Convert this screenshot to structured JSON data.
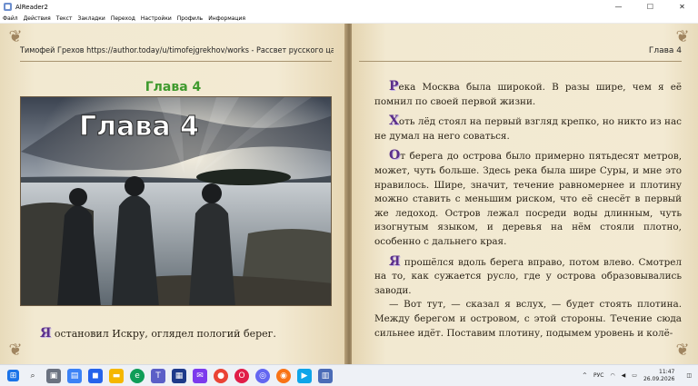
{
  "window": {
    "title": "AlReader2",
    "minimize_glyph": "—",
    "maximize_glyph": "☐",
    "close_glyph": "✕"
  },
  "menu": {
    "items": [
      {
        "label": "Файл"
      },
      {
        "label": "Действия"
      },
      {
        "label": "Текст"
      },
      {
        "label": "Закладки"
      },
      {
        "label": "Переход"
      },
      {
        "label": "Настройки"
      },
      {
        "label": "Профиль"
      },
      {
        "label": "Информация"
      }
    ]
  },
  "left_page": {
    "header": "Тимофей Грехов https://author.today/u/timofejgrekhov/works - Рассвет русского царства...",
    "chapter_heading": "Глава 4",
    "illustration_title": "Глава 4",
    "paragraph": {
      "dropcap": "Я",
      "text": " остановил Искру, оглядел пологий берег."
    }
  },
  "right_page": {
    "header": "Глава 4",
    "paragraphs": [
      {
        "dropcap": "Р",
        "text": "ека Москва была широкой. В разы шире, чем я её помнил по своей первой жизни."
      },
      {
        "dropcap": "Х",
        "text": "оть лёд стоял на первый взгляд крепко, но никто из нас не думал на него соваться."
      },
      {
        "dropcap": "О",
        "text": "т берега до острова было примерно пятьдесят метров, может, чуть больше. Здесь река была шире Суры, и мне это нравилось. Шире, значит, течение равномернее и плотину можно ставить с меньшим риском, что её снесёт в первый же ледоход. Остров лежал посреди воды длинным, чуть изогнутым языком, и деревья на нём стояли плотно, особенно с дальнего края."
      },
      {
        "dropcap": "Я",
        "text": " прошёлся вдоль берега вправо, потом влево. Смотрел на то, как сужается русло, где у острова образовывались заводи."
      },
      {
        "dropcap": "",
        "text": "— Вот тут, — сказал я вслух, — будет стоять плотина. Между берегом и островом, с этой стороны. Течение сюда сильнее идёт. Поставим плотину, подымем уровень и колё-"
      }
    ]
  },
  "taskbar": {
    "language": "РУС",
    "time": "11:47",
    "date": "26.09.2026",
    "icons": [
      "windows-start-icon",
      "search-icon",
      "task-view-icon",
      "widgets-icon",
      "store-icon",
      "file-explorer-icon",
      "edge-icon",
      "teams-icon",
      "app-blue-icon",
      "mail-icon",
      "chrome-icon",
      "opera-icon",
      "browser-icon",
      "firefox-icon",
      "media-icon",
      "alreader-icon"
    ]
  },
  "colors": {
    "page": "#f2e9d1",
    "chapter_heading": "#3f9a2e",
    "dropcap": "#5b2f8a",
    "text": "#2b2418"
  }
}
